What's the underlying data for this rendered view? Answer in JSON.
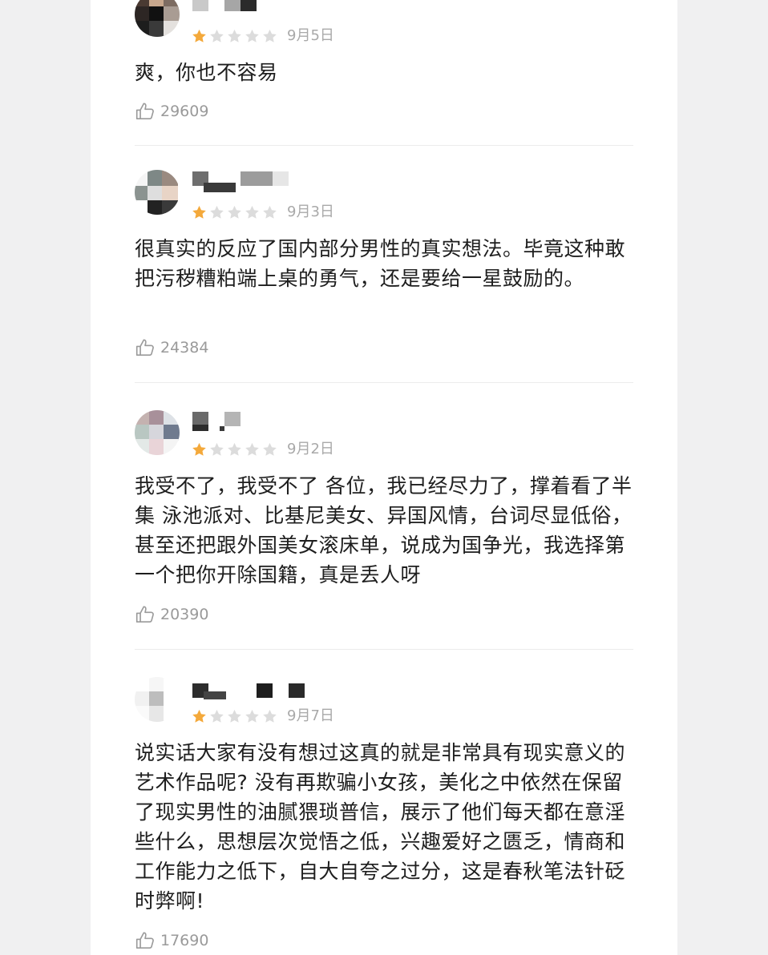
{
  "reviews": [
    {
      "date": "9月5日",
      "rating": 1,
      "max_rating": 5,
      "text": "爽，你也不容易",
      "likes": "29609"
    },
    {
      "date": "9月3日",
      "rating": 1,
      "max_rating": 5,
      "text": "很真实的反应了国内部分男性的真实想法。毕竟这种敢把污秽糟粕端上桌的勇气，还是要给一星鼓励的。",
      "likes": "24384"
    },
    {
      "date": "9月2日",
      "rating": 1,
      "max_rating": 5,
      "text": "我受不了，我受不了 各位，我已经尽力了，撑着看了半集 泳池派对、比基尼美女、异国风情，台词尽显低俗，甚至还把跟外国美女滚床单，说成为国争光，我选择第一个把你开除国籍，真是丢人呀",
      "likes": "20390"
    },
    {
      "date": "9月7日",
      "rating": 1,
      "max_rating": 5,
      "text": "说实话大家有没有想过这真的就是非常具有现实意义的艺术作品呢? 没有再欺骗小女孩，美化之中依然在保留了现实男性的油腻猥琐普信，展示了他们每天都在意淫些什么，思想层次觉悟之低，兴趣爱好之匮乏，情商和工作能力之低下，自大自夸之过分，这是春秋笔法针砭时弊啊!",
      "likes": "17690"
    }
  ],
  "colors": {
    "star_filled": "#f4a93b",
    "star_empty": "#dcdcdc",
    "text": "#1e1e1e",
    "meta": "#a9a9a9"
  },
  "icons": {
    "like": "thumbs-up-icon",
    "star": "star-icon"
  }
}
